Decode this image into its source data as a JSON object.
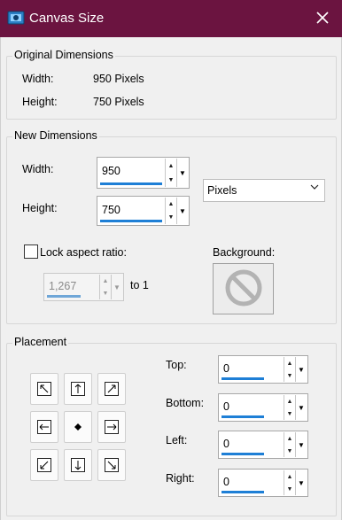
{
  "window": {
    "title": "Canvas Size",
    "icon": "canvas-app-icon",
    "close_icon": "close-icon"
  },
  "original": {
    "group_label": "Original Dimensions",
    "width_label": "Width:",
    "width_value": "950 Pixels",
    "height_label": "Height:",
    "height_value": "750 Pixels"
  },
  "new_dimensions": {
    "group_label": "New Dimensions",
    "width_label": "Width:",
    "width_value": "950",
    "height_label": "Height:",
    "height_value": "750",
    "unit_value": "Pixels",
    "lock_label": "Lock aspect ratio:",
    "lock_checked": false,
    "ratio_value": "1,267",
    "to_label": "to 1",
    "background_label": "Background:",
    "background_icon": "no-color-icon"
  },
  "placement": {
    "group_label": "Placement",
    "top_label": "Top:",
    "top_value": "0",
    "bottom_label": "Bottom:",
    "bottom_value": "0",
    "left_label": "Left:",
    "left_value": "0",
    "right_label": "Right:",
    "right_value": "0",
    "selected": "center",
    "accent": "#1e7fd6"
  }
}
